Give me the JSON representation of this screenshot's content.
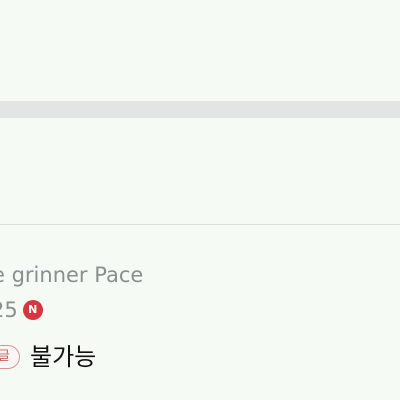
{
  "list_item": {
    "title": "e grinner Pace",
    "count": "25",
    "new_badge": "N",
    "status_tag": "글",
    "status_text": "불가능",
    "colors": {
      "background": "#f6faf5",
      "divider": "#e2e5e3",
      "badge": "#d6363f",
      "tag_border": "#d99593",
      "muted_text": "#8b8f8c"
    }
  }
}
